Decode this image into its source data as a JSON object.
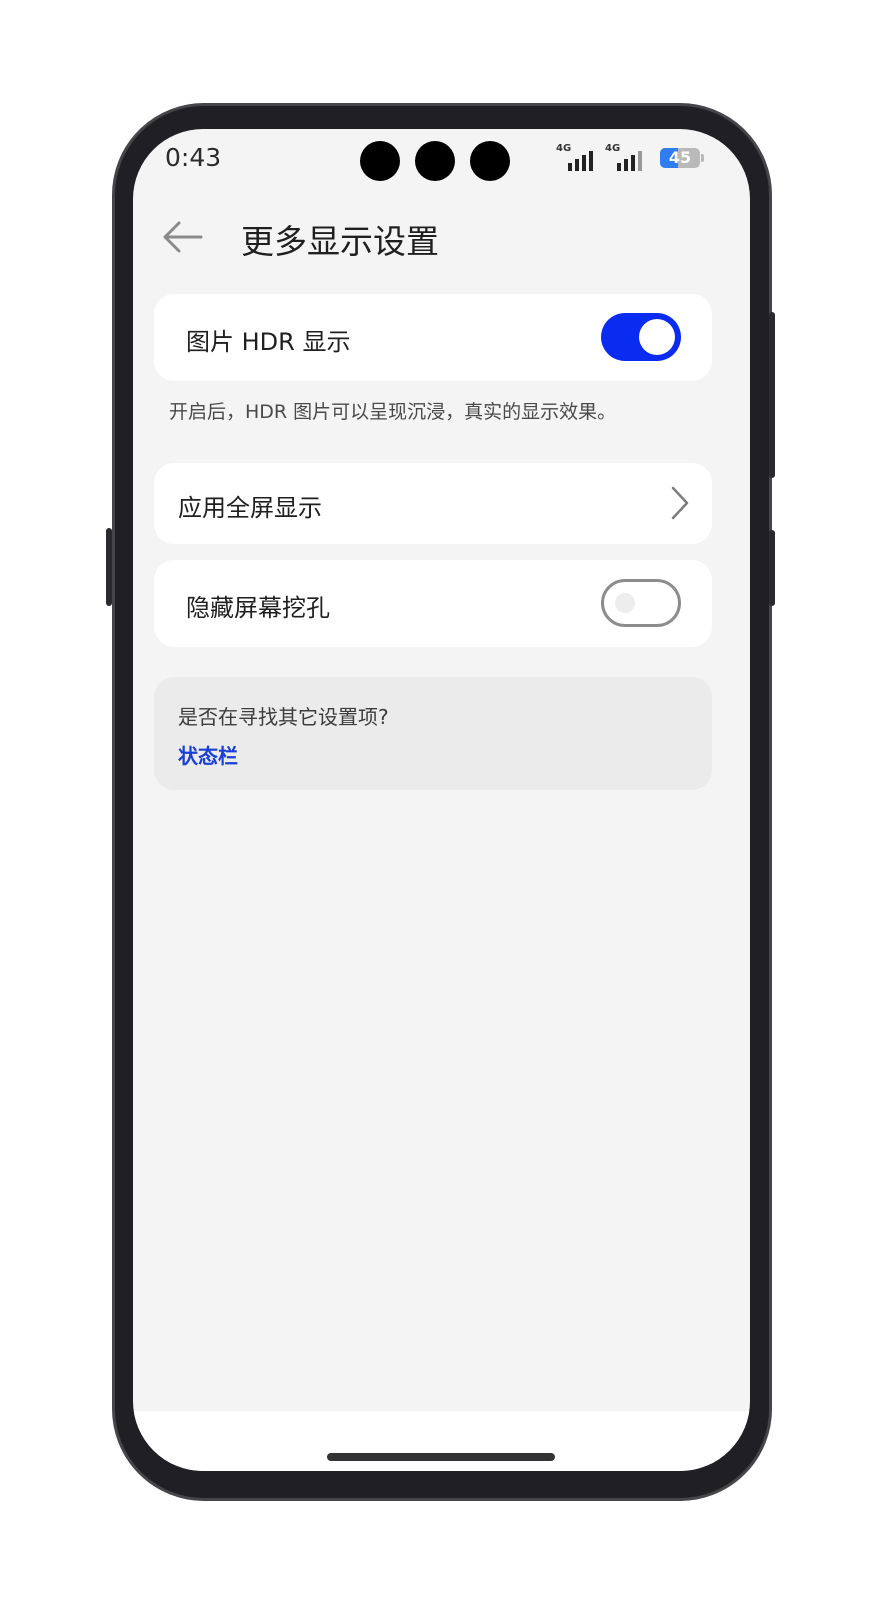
{
  "status_bar": {
    "time": "0:43",
    "sim1_label": "4G",
    "sim2_label": "4G",
    "battery_percent": "45",
    "battery_level": 0.45,
    "battery_color": "#2f7df0"
  },
  "header": {
    "back_icon": "arrow-left-icon",
    "title": "更多显示设置"
  },
  "settings": {
    "hdr": {
      "label": "图片 HDR 显示",
      "enabled": true,
      "hint": "开启后，HDR 图片可以呈现沉浸，真实的显示效果。"
    },
    "fullscreen_apps": {
      "label": "应用全屏显示",
      "icon": "chevron-right-icon"
    },
    "hide_notch": {
      "label": "隐藏屏幕挖孔",
      "enabled": false
    }
  },
  "suggestion": {
    "question": "是否在寻找其它设置项?",
    "link": "状态栏"
  },
  "colors": {
    "accent": "#0a2cf0",
    "link": "#1a3fd6",
    "background": "#f4f4f4"
  }
}
